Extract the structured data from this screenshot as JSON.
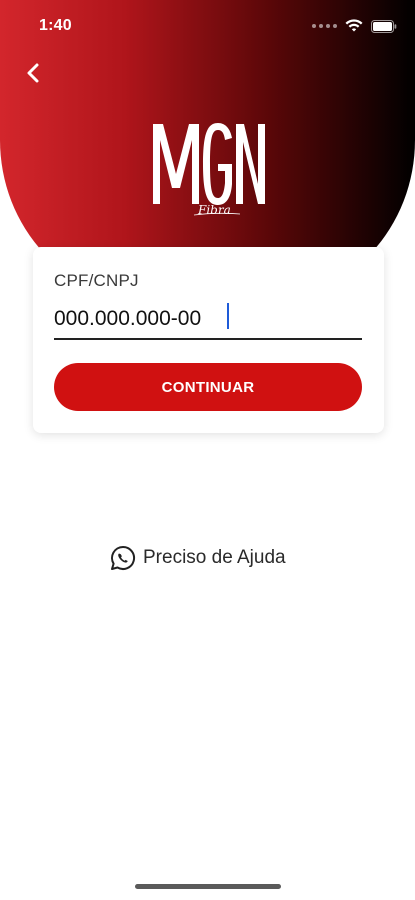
{
  "status_bar": {
    "time": "1:40"
  },
  "header": {
    "back_icon": "chevron-left-icon",
    "logo_text": "MGN",
    "logo_subtext": "Fibra"
  },
  "form": {
    "label": "CPF/CNPJ",
    "value": "000.000.000-00",
    "continue_label": "CONTINUAR"
  },
  "help": {
    "icon": "whatsapp-icon",
    "label": "Preciso de Ajuda"
  },
  "colors": {
    "brand_red": "#d01111",
    "gradient_start": "#d3262c",
    "gradient_end": "#000000",
    "caret_blue": "#1e5bd8"
  }
}
